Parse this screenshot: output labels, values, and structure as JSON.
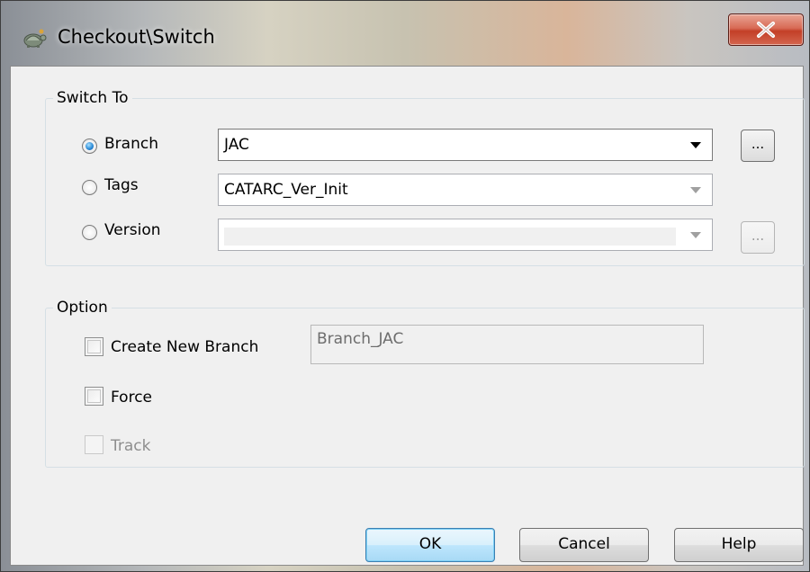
{
  "window": {
    "title": "Checkout\\Switch",
    "close_glyph": "✕"
  },
  "switch_to": {
    "legend": "Switch To",
    "branch": {
      "label": "Branch",
      "selected": true,
      "value": "JAC"
    },
    "tags": {
      "label": "Tags",
      "selected": false,
      "value": "CATARC_Ver_Init"
    },
    "version": {
      "label": "Version",
      "selected": false,
      "value": ""
    },
    "browse_label": "..."
  },
  "option": {
    "legend": "Option",
    "create_new_branch": {
      "label": "Create New Branch",
      "checked": false,
      "value": "Branch_JAC"
    },
    "force": {
      "label": "Force",
      "checked": false
    },
    "track": {
      "label": "Track",
      "checked": false,
      "disabled": true
    }
  },
  "buttons": {
    "ok": "OK",
    "cancel": "Cancel",
    "help": "Help"
  },
  "colors": {
    "default_button_border": "#3c7fb1",
    "radio_selected": "#2f8ed8",
    "close_button": "#c33f27"
  }
}
